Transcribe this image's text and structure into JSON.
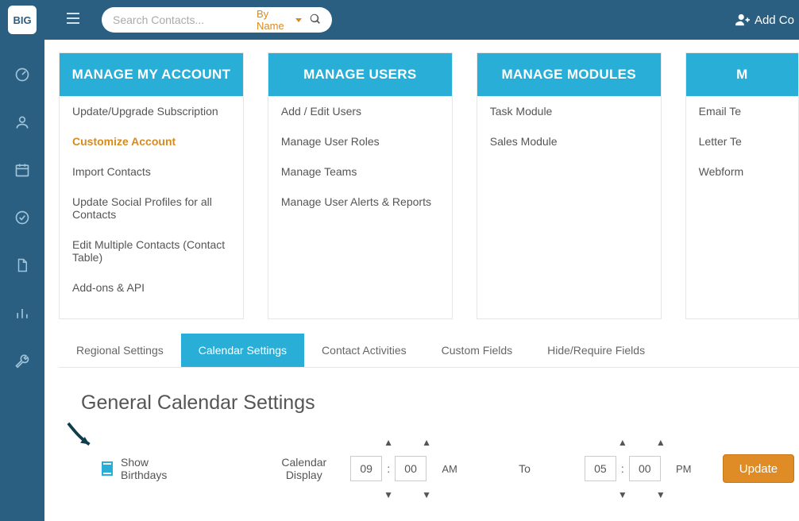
{
  "topbar": {
    "logo": "BIG",
    "search_placeholder": "Search Contacts...",
    "search_filter": "By Name",
    "add_contact": "Add Co"
  },
  "cards": [
    {
      "title": "MANAGE MY ACCOUNT",
      "items": [
        {
          "label": "Update/Upgrade Subscription",
          "active": false
        },
        {
          "label": "Customize Account",
          "active": true
        },
        {
          "label": "Import Contacts",
          "active": false
        },
        {
          "label": "Update Social Profiles for all Contacts",
          "active": false
        },
        {
          "label": "Edit Multiple Contacts (Contact Table)",
          "active": false
        },
        {
          "label": "Add-ons & API",
          "active": false
        }
      ]
    },
    {
      "title": "MANAGE USERS",
      "items": [
        {
          "label": "Add / Edit Users"
        },
        {
          "label": "Manage User Roles"
        },
        {
          "label": "Manage Teams"
        },
        {
          "label": "Manage User Alerts & Reports"
        }
      ]
    },
    {
      "title": "MANAGE MODULES",
      "items": [
        {
          "label": "Task Module"
        },
        {
          "label": "Sales Module"
        }
      ]
    },
    {
      "title": "M",
      "items": [
        {
          "label": "Email Te"
        },
        {
          "label": "Letter Te"
        },
        {
          "label": "Webform"
        }
      ]
    }
  ],
  "tabs": [
    {
      "label": "Regional Settings",
      "active": false
    },
    {
      "label": "Calendar Settings",
      "active": true
    },
    {
      "label": "Contact Activities",
      "active": false
    },
    {
      "label": "Custom Fields",
      "active": false
    },
    {
      "label": "Hide/Require Fields",
      "active": false
    }
  ],
  "calendar": {
    "heading": "General Calendar Settings",
    "show_birthdays": "Show Birthdays",
    "calendar_display_label": "Calendar Display",
    "to": "To",
    "from_hour": "09",
    "from_min": "00",
    "from_ampm": "AM",
    "to_hour": "05",
    "to_min": "00",
    "to_ampm": "PM",
    "update": "Update"
  }
}
